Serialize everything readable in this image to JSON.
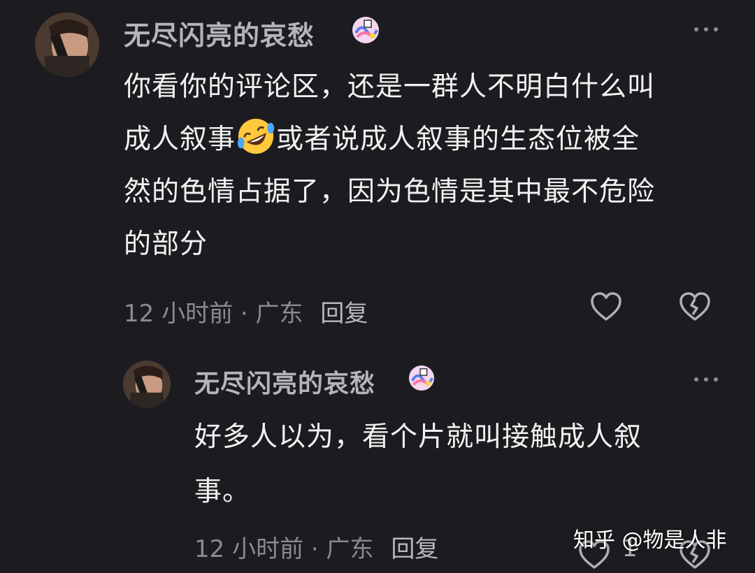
{
  "comments": [
    {
      "username": "无尽闪亮的哀愁",
      "text_lines": [
        "你看你的评论区，还是一群人不明白什么叫",
        "成人叙事",
        "或者说成人叙事的生态位被全",
        "然的色情占据了，因为色情是其中最不危险",
        "的部分"
      ],
      "emoji": "rofl-emoji",
      "time": "12 小时前",
      "separator": "·",
      "location": "广东",
      "reply_label": "回复",
      "like_icon": "heart-icon",
      "dislike_icon": "broken-heart-icon",
      "more_icon": "more-dots-icon"
    },
    {
      "username": "无尽闪亮的哀愁",
      "text_lines": [
        "好多人以为，看个片就叫接触成人叙",
        "事。"
      ],
      "time": "12 小时前",
      "separator": "·",
      "location": "广东",
      "reply_label": "回复",
      "like_count": "1",
      "like_icon": "heart-icon",
      "dislike_icon": "broken-heart-icon",
      "more_icon": "more-dots-icon"
    }
  ],
  "watermark": "知乎 @物是人非",
  "colors": {
    "background": "#1c1c20",
    "username": "#b4b4ba",
    "body_text": "#f2f2f2",
    "meta_text": "#8a8a90",
    "icon": "#b0b0b6"
  }
}
